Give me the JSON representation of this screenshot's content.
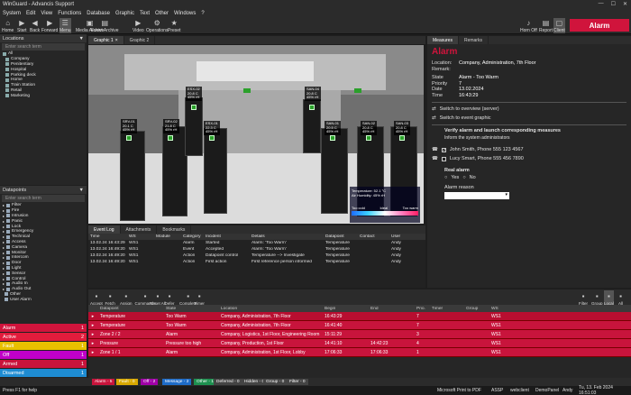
{
  "window": {
    "title": "WinGuard - Advancis Support",
    "controls": [
      "—",
      "☐",
      "✕"
    ]
  },
  "menu": [
    "System",
    "Edit",
    "View",
    "Functions",
    "Database",
    "Graphic",
    "Text",
    "Other",
    "Windows",
    "?"
  ],
  "toolbar": {
    "left": [
      {
        "label": "Home",
        "icon": "home-icon"
      },
      {
        "label": "Start",
        "icon": "start-icon"
      },
      {
        "label": "Back",
        "icon": "back-icon"
      },
      {
        "label": "Forward",
        "icon": "forward-icon"
      },
      {
        "label": "Menu",
        "icon": "menu-icon"
      },
      {
        "label": "Media Archive",
        "icon": "media-archive-icon"
      },
      {
        "label": "Event Archive",
        "icon": "event-archive-icon"
      },
      {
        "label": "Video",
        "icon": "video-icon"
      },
      {
        "label": "Operations",
        "icon": "operations-icon"
      },
      {
        "label": "Preset",
        "icon": "preset-icon"
      }
    ],
    "right": [
      {
        "label": "Horn Off",
        "icon": "horn-off-icon"
      },
      {
        "label": "Report",
        "icon": "report-icon"
      },
      {
        "label": "Client",
        "icon": "client-icon"
      }
    ],
    "alarm_button": "Alarm"
  },
  "locations": {
    "title": "Locations",
    "search_placeholder": "Enter search term",
    "items": [
      "All",
      "Company",
      "Penitentiary",
      "Hospital",
      "Parking deck",
      "Home",
      "Train Station",
      "Retail",
      "Marketing"
    ]
  },
  "datapoints": {
    "title": "Datapoints",
    "search_placeholder": "Enter search term",
    "items": [
      "Filter",
      "Fire",
      "Intrusion",
      "Panic",
      "Lock",
      "Emergency",
      "Technical",
      "Access",
      "Camera",
      "Monitor",
      "Intercom",
      "Door",
      "Light",
      "Sensor",
      "Control",
      "Audio In",
      "Audio Out",
      "Other",
      "User Alarm"
    ]
  },
  "status_panels": [
    {
      "label": "Alarm",
      "count": "1",
      "color": "#d0143c"
    },
    {
      "label": "Active",
      "count": "2",
      "color": "#e21c3c"
    },
    {
      "label": "Fault",
      "count": "1",
      "color": "#e8c000"
    },
    {
      "label": "Off",
      "count": "1",
      "color": "#c000c8"
    },
    {
      "label": "Armed",
      "count": "1",
      "color": "#c8143c"
    },
    {
      "label": "Disarmed",
      "count": "1",
      "color": "#1e8cd2"
    }
  ],
  "graphic_tabs": [
    "Graphic 1",
    "Graphic 2"
  ],
  "racks": [
    {
      "label": "SRV-01\n20.1 C\n45% rH"
    },
    {
      "label": "SRV-02\n21.8 C\n45% rH"
    },
    {
      "label": "ESX-01\n22.3 C\n45% rH"
    },
    {
      "label": "ESX-02\n20.8 C\n45% rH"
    },
    {
      "label": "SAN-04\n20.8 C\n45% rH"
    },
    {
      "label": "SAN-01\n20.5 C\n45% rH"
    },
    {
      "label": "SAN-02\n20.8 C\n45% rH"
    },
    {
      "label": "SAN-03\n20.8 C\n45% rH"
    }
  ],
  "scene_legend": {
    "temp": "Temperature: 52.1 °C",
    "humidity": "Air Humidity: 45% rH",
    "scale": [
      "Too cold",
      "Ideal",
      "Too warm"
    ]
  },
  "lower_tabs": [
    "Event Log",
    "Attachments",
    "Bookmarks"
  ],
  "event_columns": [
    "Time",
    "WS",
    "Module",
    "Category",
    "Incident",
    "Details",
    "Datapoint",
    "Contact",
    "User"
  ],
  "events": [
    [
      "13.02.24 16:43:29",
      "WS1",
      "",
      "Alarm",
      "Started",
      "Alarm: 'Too Warm'",
      "Temperature",
      "",
      "Andy"
    ],
    [
      "13.02.24 16:49:20",
      "WS1",
      "",
      "Event",
      "Accepted",
      "Alarm: 'Too Warm'",
      "Temperature",
      "",
      "Andy"
    ],
    [
      "13.02.24 16:49:20",
      "WS1",
      "",
      "Action",
      "Datapoint control",
      "Temperature --> Investigate",
      "Temperature",
      "",
      "Andy"
    ],
    [
      "13.02.24 16:49:20",
      "WS1",
      "",
      "Action",
      "First action",
      "First reference person informed",
      "Temperature",
      "",
      "Andy"
    ]
  ],
  "right_tabs": [
    "Measures",
    "Remarks"
  ],
  "measures": {
    "title": "Alarm",
    "location_label": "Location:",
    "location": "Company, Administration, 7th Floor",
    "remark_label": "Remark:",
    "state_label": "State",
    "state": "Alarm - Too Warm",
    "priority_label": "Priority",
    "priority": "7",
    "date_label": "Date",
    "date": "13.02.2024",
    "time_label": "Time",
    "time": "16:43:29",
    "links": [
      "Switch to overview (server)",
      "Switch to event graphic"
    ],
    "verify_title": "Verify alarm and launch corresponding measures",
    "inform": "Inform the system administrators",
    "contacts": [
      {
        "name": "John Smith, Phone 555 123 4567",
        "checked": "✓"
      },
      {
        "name": "Lucy Smart, Phone 555 456 7890",
        "checked": ""
      }
    ],
    "real_alarm_label": "Real alarm",
    "yes": "Yes",
    "no": "No",
    "reason_label": "Alarm reason"
  },
  "action_buttons": [
    "Accept",
    "Fetch",
    "Assign",
    "Commands",
    "Reset All",
    "Defer",
    "Complete",
    "Timer"
  ],
  "view_buttons": [
    "Filter",
    "Group",
    "Local",
    "All"
  ],
  "alarm_columns": [
    "Datapoint",
    "State",
    "Location",
    "Begin",
    "End",
    "Prio.",
    "Timer",
    "Group",
    "WS"
  ],
  "alarm_rows": [
    {
      "datapoint": "Temperature",
      "state": "Too Warm",
      "location": "Company, Administration, 7th Floor",
      "begin": "16:43:29",
      "end": "",
      "prio": "7",
      "timer": "",
      "group": "",
      "ws": "WS1",
      "color": "#b80e30"
    },
    {
      "datapoint": "Temperature",
      "state": "Too Warm",
      "location": "Company, Administration, 7th Floor",
      "begin": "16:41:40",
      "end": "",
      "prio": "7",
      "timer": "",
      "group": "",
      "ws": "WS1",
      "color": "#c8143c"
    },
    {
      "datapoint": "Zone 2 / 2",
      "state": "Alarm",
      "location": "Company, Logistics, 1st Floor, Engineering Room",
      "begin": "15:11:29",
      "end": "",
      "prio": "3",
      "timer": "",
      "group": "",
      "ws": "WS1",
      "color": "#c8143c"
    },
    {
      "datapoint": "Pressure",
      "state": "Pressure too high",
      "location": "Company, Production, 1st Floor",
      "begin": "14:41:10",
      "end": "14:42:23",
      "prio": "4",
      "timer": "",
      "group": "",
      "ws": "WS1",
      "color": "#c8143c"
    },
    {
      "datapoint": "Zone 1 / 1",
      "state": "Alarm",
      "location": "Company, Administration, 1st Floor, Lobby",
      "begin": "17:06:33",
      "end": "17:06:33",
      "prio": "1",
      "timer": "",
      "group": "",
      "ws": "WS1",
      "color": "#c8143c"
    }
  ],
  "bottom_chips": [
    {
      "label": "Alarm - 5",
      "color": "#c8143c"
    },
    {
      "label": "Fault - 0",
      "color": "#d8a800"
    },
    {
      "label": "Off - 2",
      "color": "#a000a8"
    },
    {
      "label": "Message - 2",
      "color": "#1e6cc8"
    },
    {
      "label": "Other - 1",
      "color": "#1e9050"
    },
    {
      "label": "Deferred - 0",
      "color": "#444444"
    },
    {
      "label": "Hidden - 0",
      "color": "#444444"
    },
    {
      "label": "Group - 0",
      "color": "#444444"
    },
    {
      "label": "Filter - 0",
      "color": "#444444"
    }
  ],
  "status": {
    "help": "Press F1 for help",
    "printer": "Microsoft Print to PDF",
    "user_code": "ASSP",
    "server": "webclient",
    "panel": "DemoPanel",
    "user": "Andy",
    "datetime": "Tu, 13. Feb 2024  16:51:03"
  }
}
